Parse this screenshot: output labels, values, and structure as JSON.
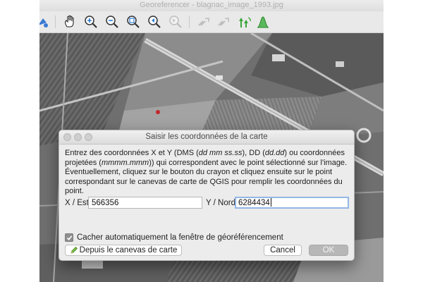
{
  "window": {
    "title": "Georeferencer - blagnac_image_1993.jpg"
  },
  "toolbar": {
    "icons": [
      "add-point-icon",
      "pan-icon",
      "zoom-in-icon",
      "zoom-out-icon",
      "zoom-to-layer-icon",
      "zoom-last-icon",
      "zoom-next-icon",
      "link-georef-to-qgis-icon",
      "link-qgis-to-georef-icon",
      "transformation-settings-icon",
      "histogram-stretch-icon"
    ]
  },
  "dialog": {
    "title": "Saisir les coordonnées de la carte",
    "description": {
      "p1": "Entrez des coordonnées X et Y (DMS (",
      "p1_em": "dd mm ss.ss",
      "p2": "), DD (",
      "p2_em": "dd.dd",
      "p3": ") ou coordonnées projetées (",
      "p3_em": "mmmm.mmm",
      "p4": ")) qui correspondent avec le point sélectionné sur l'image. Éventuellement, cliquez sur le bouton du crayon et cliquez ensuite sur le point correspondant sur le canevas de carte de QGIS pour remplir les coordonnées du point."
    },
    "x_label": "X / Est",
    "x_value": "566356",
    "y_label": "Y / Nord",
    "y_value": "6284434",
    "checkbox_label": "Cacher automatiquement la fenêtre de géoréférencement",
    "checkbox_checked": true,
    "from_canvas_label": "Depuis le canevas de carte",
    "cancel_label": "Cancel",
    "ok_label": "OK"
  },
  "colors": {
    "accent_green": "#3aa63a",
    "focus_ring": "#93b6e6",
    "point_marker": "#c0282d"
  }
}
